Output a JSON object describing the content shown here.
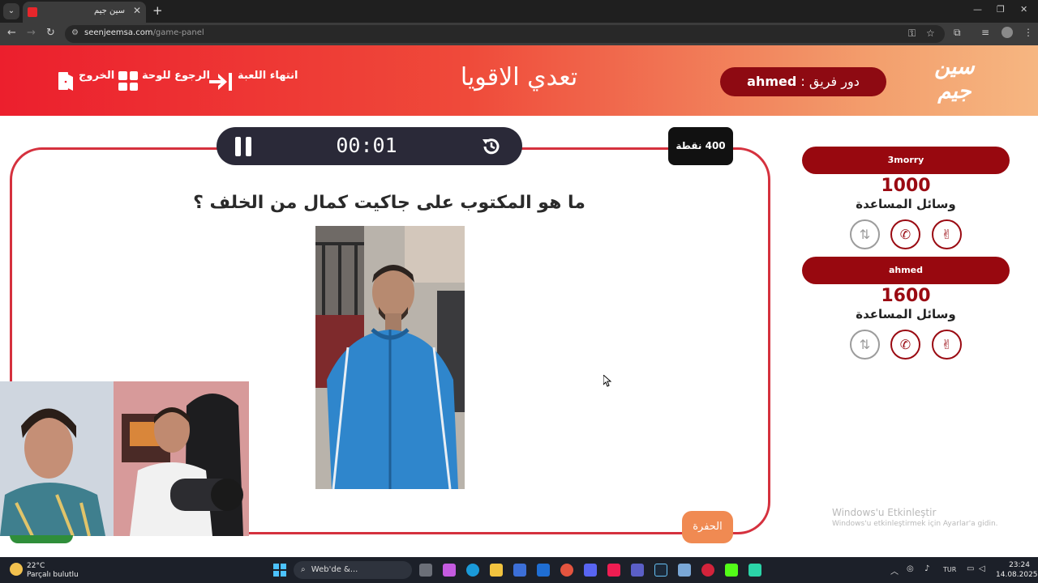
{
  "browser": {
    "tab_title": "سين جيم",
    "url_domain": "seenjeemsa.com",
    "url_path": "/game-panel"
  },
  "header": {
    "exit_label": "الخروج",
    "back_to_board_label": "الرجوع للوحة",
    "end_game_label": "انتهاء اللعبة",
    "title": "تعدي الاقويا",
    "turn_prefix": "دور فريق :",
    "turn_team": "ahmed",
    "logo_text_top": "سين",
    "logo_text_bottom": "جيم"
  },
  "question_panel": {
    "timer": "00:01",
    "points_label": "400 نقطة",
    "question": "ما هو المكتوب على جاكيت كمال من الخلف ؟",
    "hole_button_label": "الحفرة"
  },
  "teams": [
    {
      "name": "3morry",
      "score": "1000",
      "aids_label": "وسائل المساعدة"
    },
    {
      "name": "ahmed",
      "score": "1600",
      "aids_label": "وسائل المساعدة"
    }
  ],
  "watermark": {
    "line1": "Windows'u Etkinleştir",
    "line2": "Windows'u etkinleştirmek için Ayarlar'a gidin."
  },
  "taskbar": {
    "temp": "22°C",
    "weather_text": "Parçalı bulutlu",
    "search_label": "Web'de &...",
    "language": "TUR",
    "time": "23:24",
    "date": "14.08.2025"
  },
  "colors": {
    "header_red": "#ec1f2d",
    "header_orange": "#f6b681",
    "dark_red": "#98080f",
    "frame_red": "#d5313e",
    "timer_bg": "#2a2938",
    "hole_orange": "#f08a52"
  }
}
